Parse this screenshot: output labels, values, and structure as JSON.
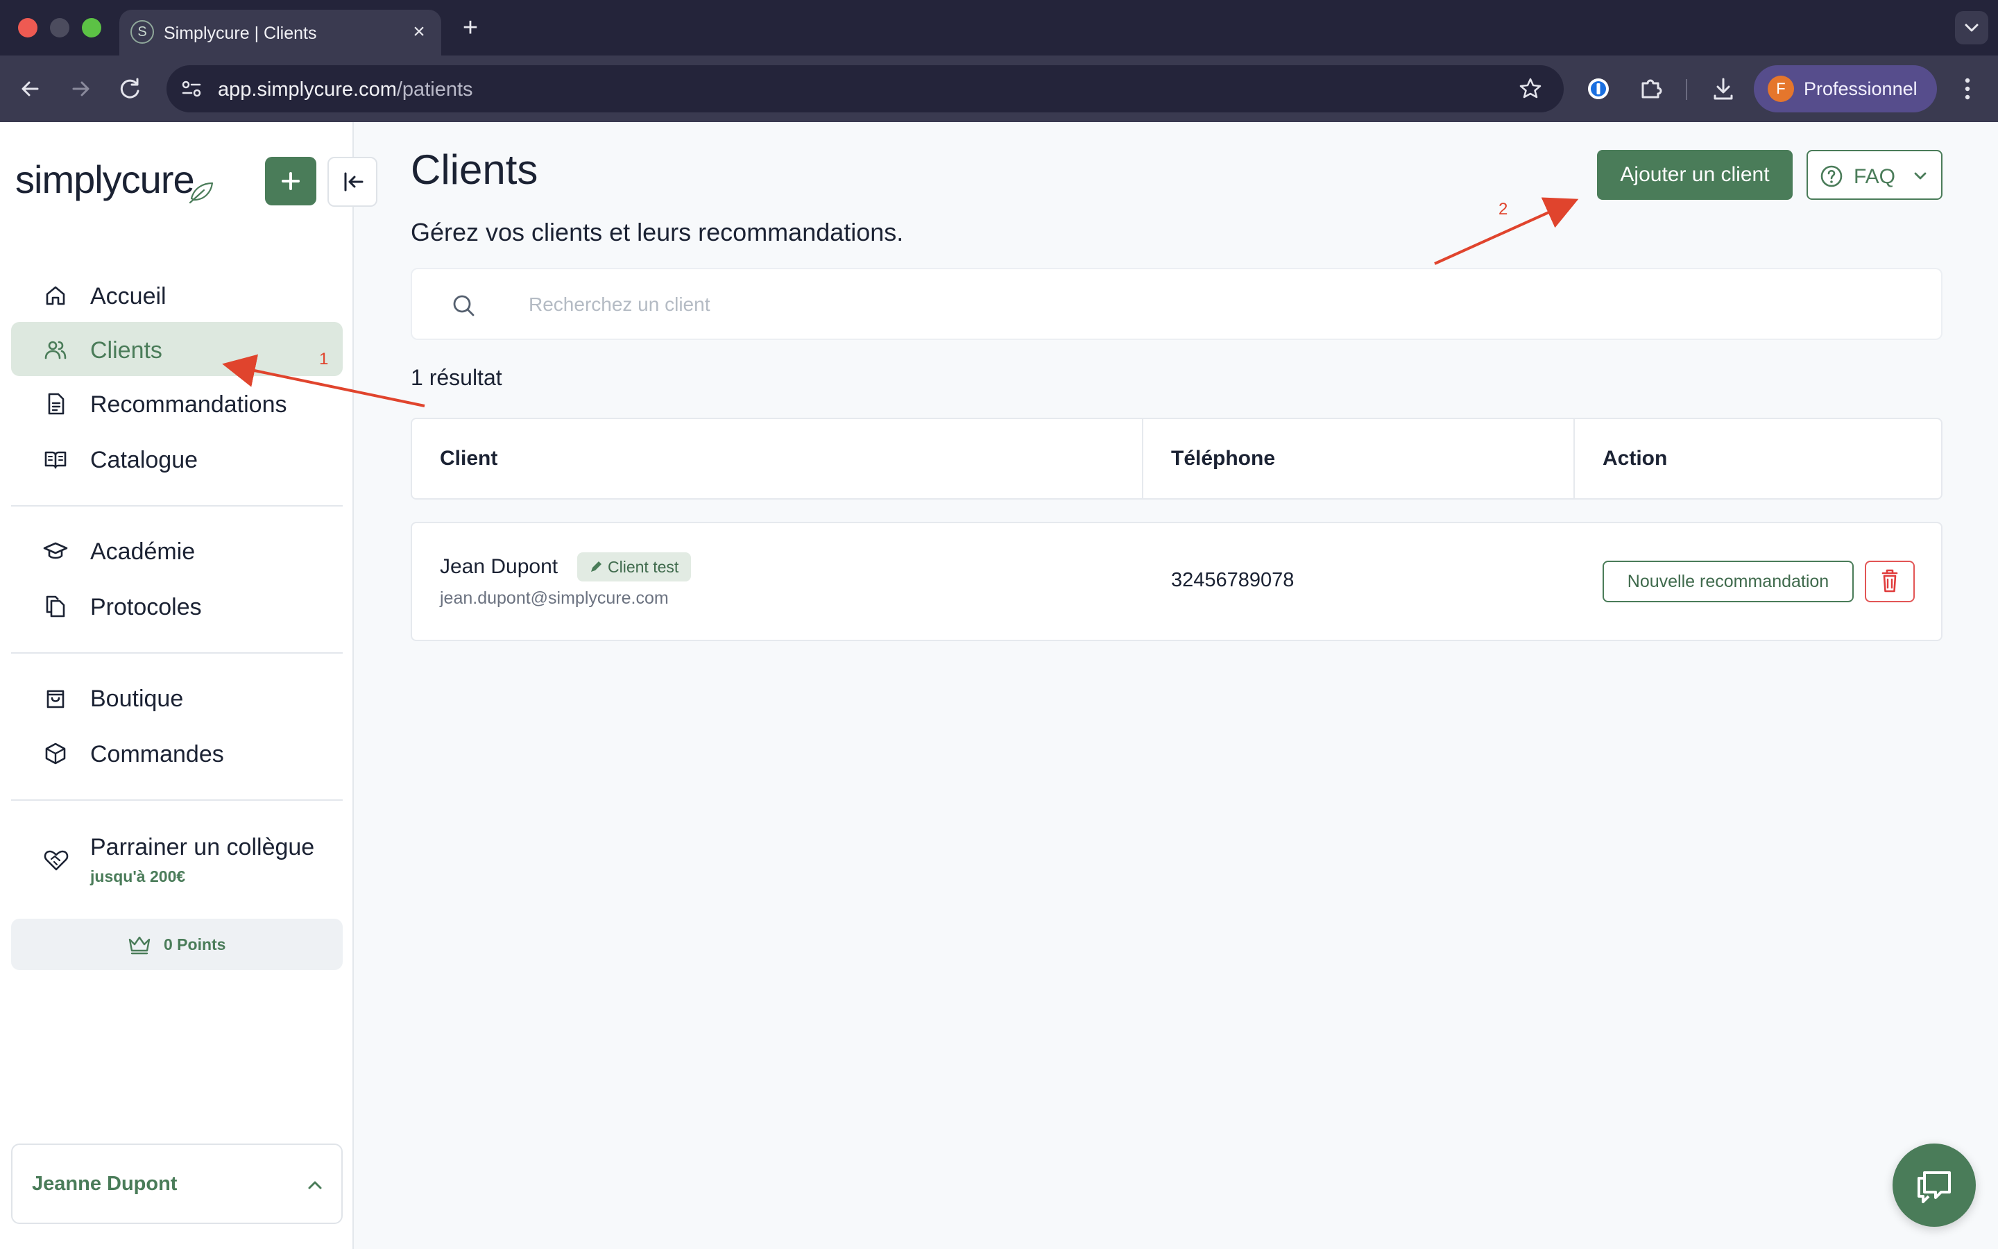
{
  "colors": {
    "brand_green": "#4a7c59",
    "active_nav_bg": "#dde8df",
    "danger_red": "#e03c3c",
    "annotation_red": "#e0442d",
    "browser_dark": "#24243a",
    "profile_purple": "#564d8c"
  },
  "browser": {
    "tab_title": "Simplycure | Clients",
    "tab_favicon_letter": "S",
    "url_host": "app.simplycure.com",
    "url_path": "/patients",
    "profile_initial": "F",
    "profile_name": "Professionnel"
  },
  "sidebar": {
    "logo_text": "simplycure",
    "main_nav": [
      {
        "label": "Accueil",
        "icon": "home-icon"
      },
      {
        "label": "Clients",
        "icon": "users-icon",
        "active": true
      },
      {
        "label": "Recommandations",
        "icon": "document-icon"
      },
      {
        "label": "Catalogue",
        "icon": "book-icon"
      }
    ],
    "learn_nav": [
      {
        "label": "Académie",
        "icon": "graduation-cap-icon"
      },
      {
        "label": "Protocoles",
        "icon": "copy-icon"
      }
    ],
    "shop_nav": [
      {
        "label": "Boutique",
        "icon": "shopping-bag-icon"
      },
      {
        "label": "Commandes",
        "icon": "package-icon"
      }
    ],
    "referral": {
      "label": "Parrainer un collègue",
      "sub": "jusqu'à 200€",
      "icon": "handshake-heart-icon"
    },
    "points_label": "0 Points",
    "user_name": "Jeanne Dupont"
  },
  "main": {
    "title": "Clients",
    "subtitle": "Gérez vos clients et leurs recommandations.",
    "add_button_label": "Ajouter un client",
    "faq_label": "FAQ",
    "search_placeholder": "Recherchez un client",
    "result_count": "1 résultat",
    "table": {
      "headers": [
        "Client",
        "Téléphone",
        "Action"
      ],
      "rows": [
        {
          "name": "Jean Dupont",
          "badge": "Client test",
          "email": "jean.dupont@simplycure.com",
          "phone": "32456789078",
          "action_label": "Nouvelle recommandation"
        }
      ]
    }
  },
  "annotations": [
    "1",
    "2"
  ]
}
